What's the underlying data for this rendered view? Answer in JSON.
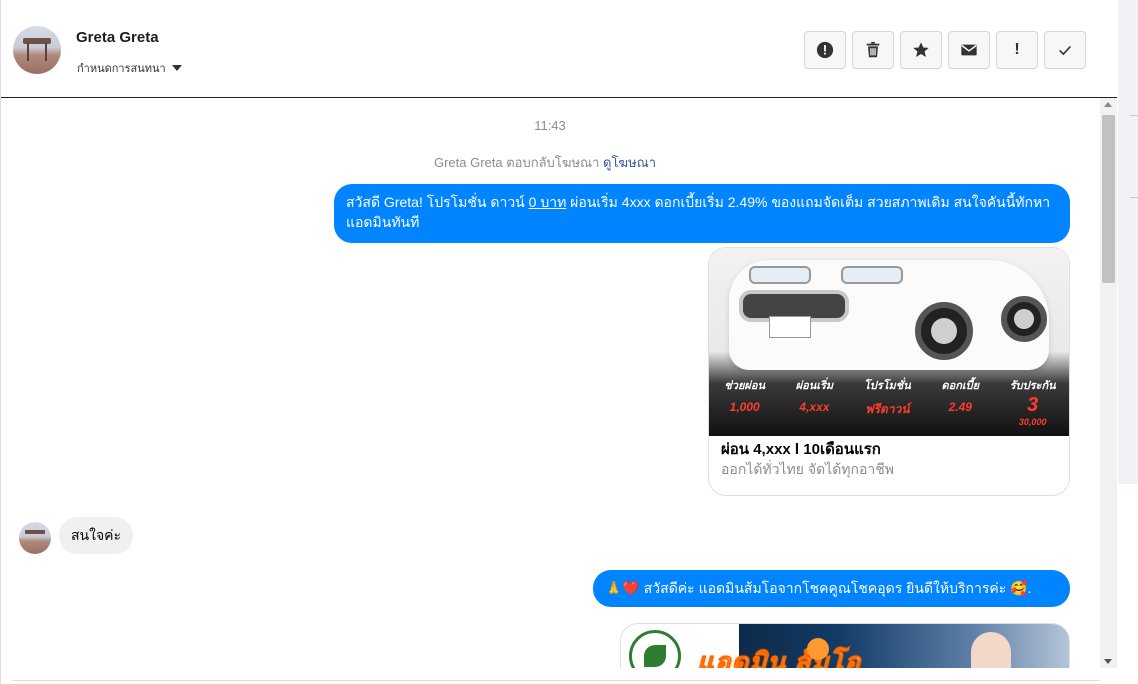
{
  "header": {
    "name": "Greta Greta",
    "assign_label": "กำหนดการสนทนา",
    "toolbar": [
      {
        "name": "report-button",
        "icon": "alert-circle-icon"
      },
      {
        "name": "delete-button",
        "icon": "trash-icon"
      },
      {
        "name": "star-button",
        "icon": "star-icon"
      },
      {
        "name": "mark-unread-button",
        "icon": "envelope-icon"
      },
      {
        "name": "important-button",
        "icon": "exclamation-icon",
        "label": "!"
      },
      {
        "name": "done-button",
        "icon": "check-icon"
      }
    ]
  },
  "thread": {
    "timestamp": "11:43",
    "ad_reply_text": "Greta Greta ตอบกลับโฆษณา",
    "ad_reply_link": "ดูโฆษณา",
    "msg1_part1": "สวัสดี Greta! โปรโมชั่น ดาวน์ ",
    "msg1_underlined": "0 บาท",
    "msg1_part2": " ผ่อนเริ่ม 4xxx ดอกเบี้ยเริ่ม 2.49% ของแถมจัดเต็ม สวยสภาพเดิม สนใจคันนี้ทักหาแอดมินทันที",
    "card": {
      "promo": [
        {
          "label": "ช่วยผ่อน",
          "value": "1,000"
        },
        {
          "label": "ผ่อนเริ่ม",
          "value": "4,xxx"
        },
        {
          "label": "โปรโมชั่น",
          "value": "ฟรีดาวน์"
        },
        {
          "label": "ดอกเบี้ย",
          "value": "2.49"
        },
        {
          "label": "รับประกัน",
          "value": "3",
          "extra": "30,000"
        }
      ],
      "title": "ผ่อน 4,xxx l 10เดือนแรก",
      "subtitle": "ออกได้ทั่วไทย จัดได้ทุกอาชีพ"
    },
    "reply_in": "สนใจค่ะ",
    "msg2_emoji_left": "🙏❤️",
    "msg2_text": "สวัสดีค่ะ แอดมินส้มโอจากโชคคูณโชคอุดร ยินดีให้บริการค่ะ",
    "msg2_emoji_right": "🥰",
    "msg2_end": ".",
    "banner_text": "แอดมิน ส้มโอ"
  },
  "colors": {
    "accent": "#0084ff",
    "incoming_bubble": "#f0f0f0",
    "muted_text": "#8a8d91"
  }
}
